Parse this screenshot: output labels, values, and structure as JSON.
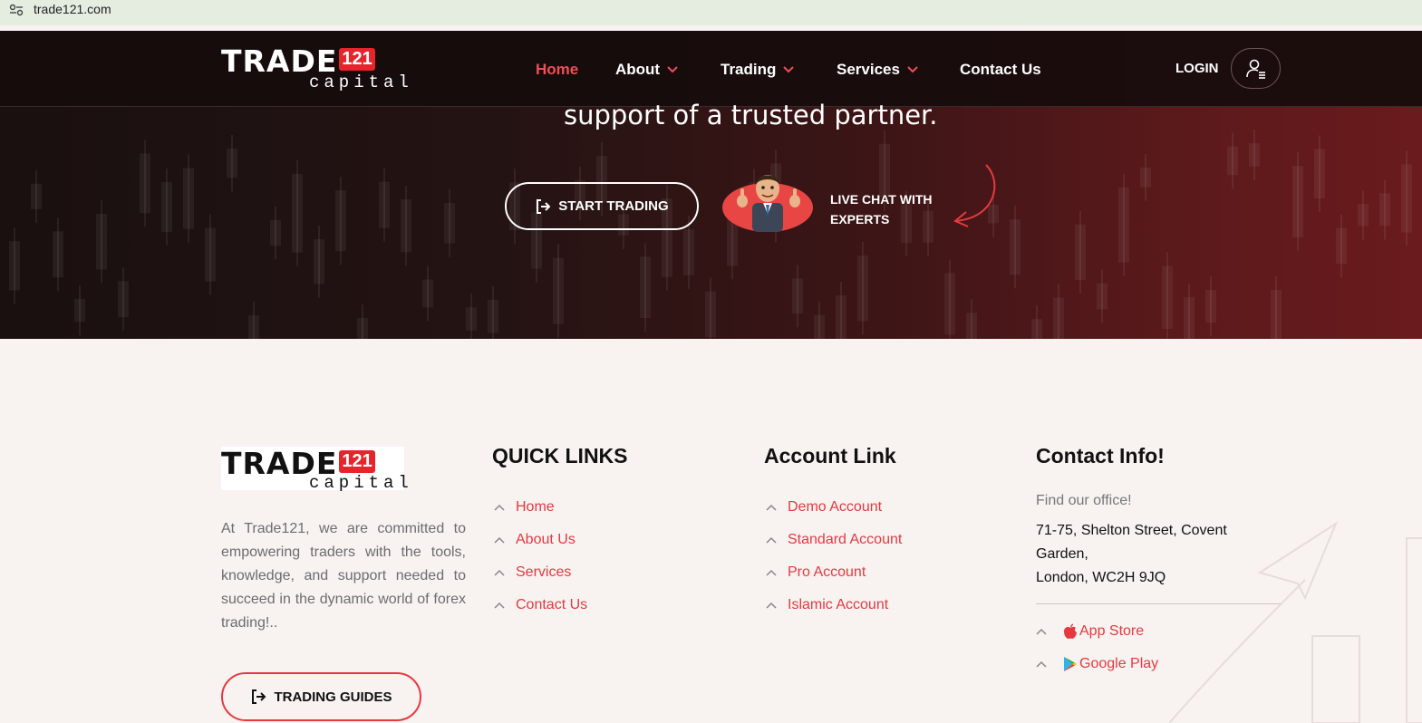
{
  "browser": {
    "url": "trade121.com"
  },
  "brand": {
    "word": "TRADE",
    "number": "121",
    "sub": "capital"
  },
  "nav": {
    "items": [
      {
        "label": "Home",
        "active": true
      },
      {
        "label": "About",
        "dropdown": true
      },
      {
        "label": "Trading",
        "dropdown": true
      },
      {
        "label": "Services",
        "dropdown": true
      },
      {
        "label": "Contact Us"
      }
    ],
    "login": "LOGIN"
  },
  "hero": {
    "text": "support of a trusted partner.",
    "start_button": "START TRADING",
    "chat_line1": "LIVE CHAT WITH",
    "chat_line2": "EXPERTS"
  },
  "footer": {
    "about": "At Trade121, we are committed to empowering traders with the tools, knowledge, and support needed to succeed in the dynamic world of forex trading!..",
    "guides_button": "TRADING GUIDES",
    "quick_links": {
      "title": "QUICK LINKS",
      "items": [
        "Home",
        "About Us",
        "Services",
        "Contact Us"
      ]
    },
    "account_links": {
      "title": "Account Link",
      "items": [
        "Demo Account",
        "Standard Account",
        "Pro Account",
        "Islamic Account"
      ]
    },
    "contact": {
      "title": "Contact Info!",
      "find": "Find our office!",
      "address_line1": "71-75, Shelton Street, Covent Garden,",
      "address_line2": "London, WC2H 9JQ",
      "app_store": "App Store",
      "google_play": "Google Play"
    }
  },
  "colors": {
    "accent": "#e5393f",
    "hero_dark": "#1a1010",
    "footer_bg": "#f8f2f1"
  }
}
